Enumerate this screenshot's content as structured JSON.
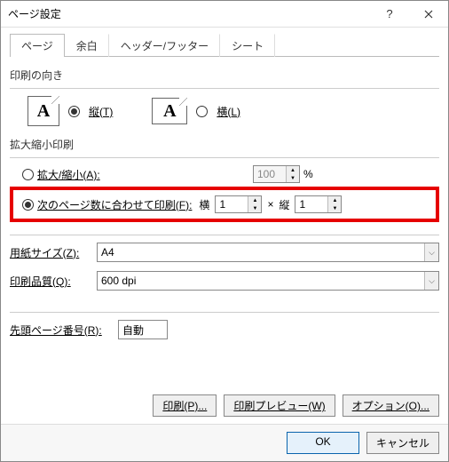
{
  "window": {
    "title": "ページ設定"
  },
  "tabs": {
    "page": "ページ",
    "margins": "余白",
    "headerfooter": "ヘッダー/フッター",
    "sheet": "シート"
  },
  "orientation": {
    "group": "印刷の向き",
    "portrait": "縦(T)",
    "landscape": "横(L)"
  },
  "scaling": {
    "group": "拡大縮小印刷",
    "adjust": "拡大/縮小(A):",
    "adjust_val": "100",
    "adjust_suffix": "%",
    "fit": "次のページ数に合わせて印刷(F):",
    "wide_label": "横",
    "wide_val": "1",
    "x": "×",
    "tall_label": "縦",
    "tall_val": "1"
  },
  "paper": {
    "label": "用紙サイズ(Z):",
    "value": "A4"
  },
  "quality": {
    "label": "印刷品質(Q):",
    "value": "600 dpi"
  },
  "firstpage": {
    "label": "先頭ページ番号(R):",
    "value": "自動"
  },
  "buttons": {
    "print": "印刷(P)...",
    "preview": "印刷プレビュー(W)",
    "options": "オプション(O)...",
    "ok": "OK",
    "cancel": "キャンセル"
  }
}
